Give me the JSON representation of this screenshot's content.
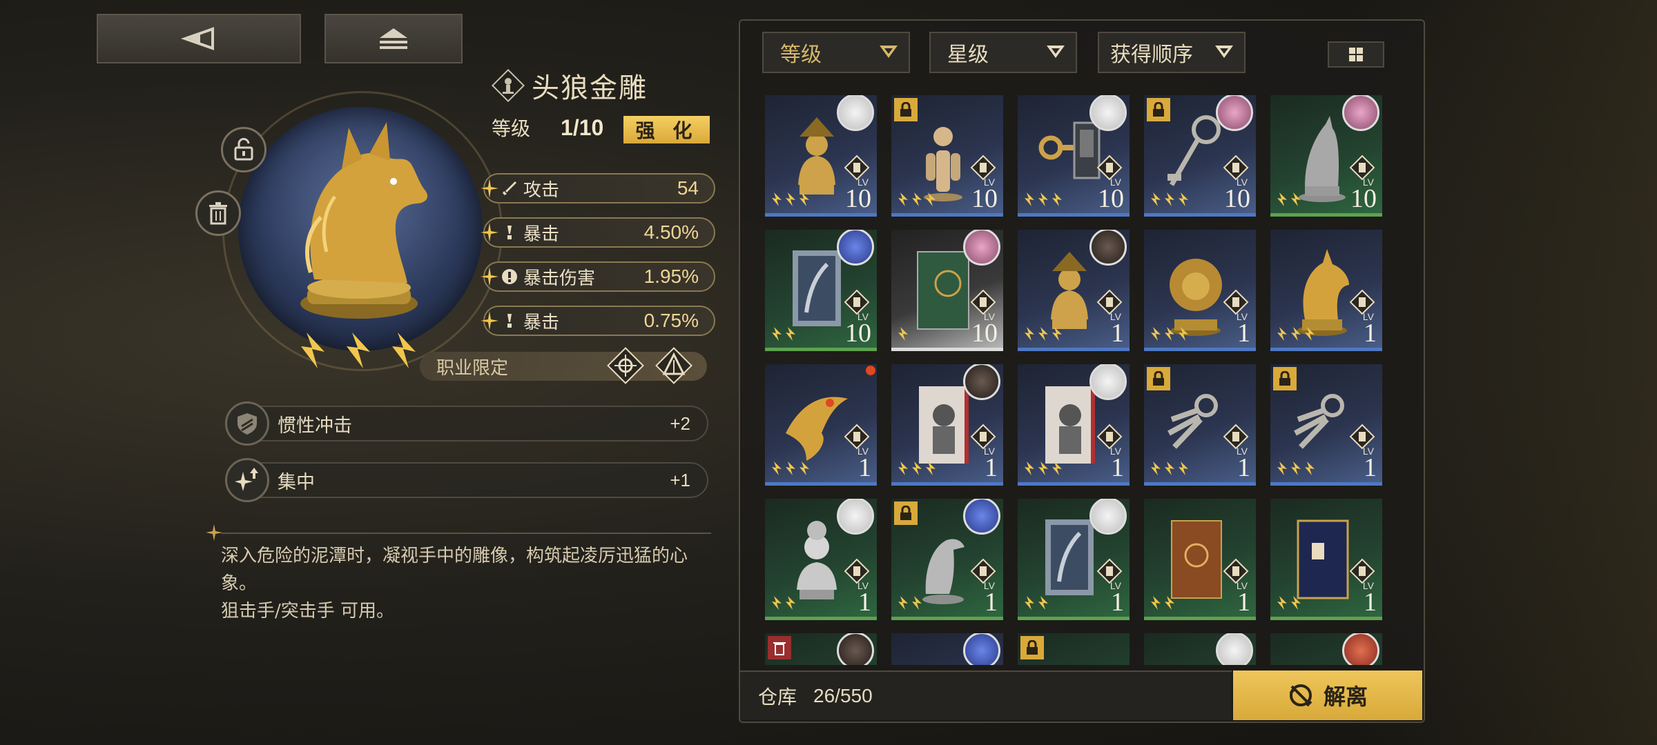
{
  "nav": {
    "back_icon": "back-arrow-icon",
    "eject_icon": "eject-icon"
  },
  "item": {
    "name": "头狼金雕",
    "level_label": "等级",
    "level_value": "1/10",
    "enhance_label": "强 化",
    "stars": 3,
    "stats": [
      {
        "name": "攻击",
        "value": "54",
        "icon": "sword-icon"
      },
      {
        "name": "暴击",
        "value": "4.50%",
        "icon": "crit-icon"
      },
      {
        "name": "暴击伤害",
        "value": "1.95%",
        "icon": "crit-damage-icon"
      },
      {
        "name": "暴击",
        "value": "0.75%",
        "icon": "crit-icon"
      }
    ],
    "class_restriction_label": "职业限定",
    "class_icons": [
      "sniper-class-icon",
      "assault-class-icon"
    ],
    "skills": [
      {
        "name": "惯性冲击",
        "value": "+2",
        "icon": "shield-icon"
      },
      {
        "name": "集中",
        "value": "+1",
        "icon": "sparkle-up-icon"
      }
    ],
    "description_line1": "深入危险的泥潭时，凝视手中的雕像，构筑起凌厉迅猛的心象。",
    "description_line2": "狙击手/突击手 可用。"
  },
  "filters": [
    {
      "label": "等级",
      "color": "#d8b76a"
    },
    {
      "label": "星级",
      "color": "#e8dcc0"
    },
    {
      "label": "获得顺序",
      "color": "#e8dcc0"
    }
  ],
  "inventory": {
    "label": "仓库",
    "count": "26/550",
    "dismantle_label": "解离",
    "cards": [
      {
        "lv": "10",
        "stars": 3,
        "bg": "blue",
        "lock": false,
        "avatar": "white",
        "art": "bust"
      },
      {
        "lv": "10",
        "stars": 3,
        "bg": "blue",
        "lock": true,
        "avatar": null,
        "art": "figure"
      },
      {
        "lv": "10",
        "stars": 3,
        "bg": "blue",
        "lock": false,
        "avatar": "white",
        "art": "keys"
      },
      {
        "lv": "10",
        "stars": 3,
        "bg": "blue",
        "lock": true,
        "avatar": "pink",
        "art": "key"
      },
      {
        "lv": "10",
        "stars": 2,
        "bg": "green",
        "lock": false,
        "avatar": "pink",
        "art": "wolf"
      },
      {
        "lv": "10",
        "stars": 2,
        "bg": "green",
        "lock": false,
        "avatar": "blue",
        "art": "book"
      },
      {
        "lv": "10",
        "stars": 1,
        "bg": "grey",
        "lock": false,
        "avatar": "pink",
        "art": "greenbook"
      },
      {
        "lv": "1",
        "stars": 3,
        "bg": "blue",
        "lock": false,
        "avatar": "dark",
        "art": "bust"
      },
      {
        "lv": "1",
        "stars": 3,
        "bg": "blue",
        "lock": false,
        "avatar": null,
        "art": "lion"
      },
      {
        "lv": "1",
        "stars": 3,
        "bg": "blue",
        "lock": false,
        "avatar": null,
        "art": "wolfgold",
        "selected": true
      },
      {
        "lv": "1",
        "stars": 3,
        "bg": "blue",
        "lock": false,
        "avatar": null,
        "art": "eagle",
        "dot": true
      },
      {
        "lv": "1",
        "stars": 3,
        "bg": "blue",
        "lock": false,
        "avatar": "dark",
        "art": "book2"
      },
      {
        "lv": "1",
        "stars": 3,
        "bg": "blue",
        "lock": false,
        "avatar": "white",
        "art": "book2"
      },
      {
        "lv": "1",
        "stars": 3,
        "bg": "blue",
        "lock": true,
        "avatar": null,
        "art": "keys2"
      },
      {
        "lv": "1",
        "stars": 3,
        "bg": "blue",
        "lock": true,
        "avatar": null,
        "art": "keys2"
      },
      {
        "lv": "1",
        "stars": 2,
        "bg": "green",
        "lock": false,
        "avatar": "white",
        "art": "statue"
      },
      {
        "lv": "1",
        "stars": 2,
        "bg": "green",
        "lock": true,
        "avatar": "blue",
        "art": "bird"
      },
      {
        "lv": "1",
        "stars": 2,
        "bg": "green",
        "lock": false,
        "avatar": "white",
        "art": "book"
      },
      {
        "lv": "1",
        "stars": 2,
        "bg": "green",
        "lock": false,
        "avatar": null,
        "art": "brownbook"
      },
      {
        "lv": "1",
        "stars": 2,
        "bg": "green",
        "lock": false,
        "avatar": null,
        "art": "navybook"
      },
      {
        "lv": "",
        "stars": 0,
        "bg": "green",
        "lock": false,
        "trash": true,
        "avatar": "dark",
        "art": ""
      },
      {
        "lv": "",
        "stars": 0,
        "bg": "blue",
        "lock": false,
        "avatar": "blue",
        "art": ""
      },
      {
        "lv": "",
        "stars": 0,
        "bg": "green",
        "lock": true,
        "avatar": null,
        "art": ""
      },
      {
        "lv": "",
        "stars": 0,
        "bg": "green",
        "lock": false,
        "avatar": "white",
        "art": ""
      },
      {
        "lv": "",
        "stars": 0,
        "bg": "green",
        "lock": false,
        "avatar": "red",
        "art": ""
      }
    ]
  },
  "lv_prefix": "LV"
}
